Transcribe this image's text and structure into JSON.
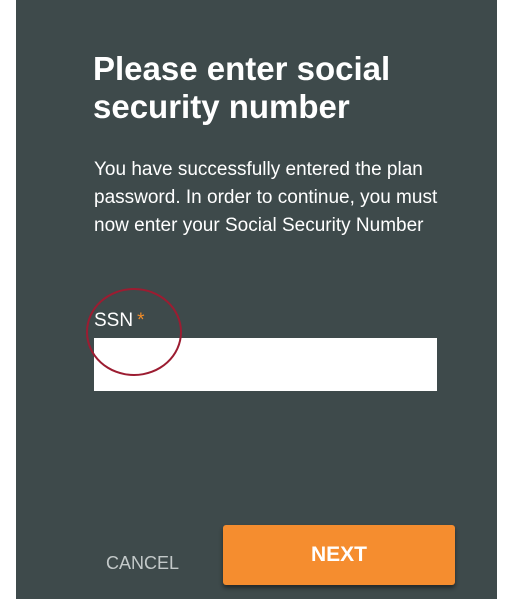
{
  "dialog": {
    "title": "Please enter social security number",
    "description": "You have successfully entered the plan password. In order to continue, you must now enter your Social Security Number",
    "field": {
      "label": "SSN",
      "required_mark": "*",
      "value": "",
      "placeholder": ""
    },
    "buttons": {
      "cancel_label": "CANCEL",
      "next_label": "NEXT"
    }
  },
  "colors": {
    "dialog_background": "#3e4a4b",
    "accent": "#f58d2f",
    "required_mark": "#f28c28",
    "highlight_circle": "#9c1c31",
    "cancel_text": "#c3c9c9"
  }
}
